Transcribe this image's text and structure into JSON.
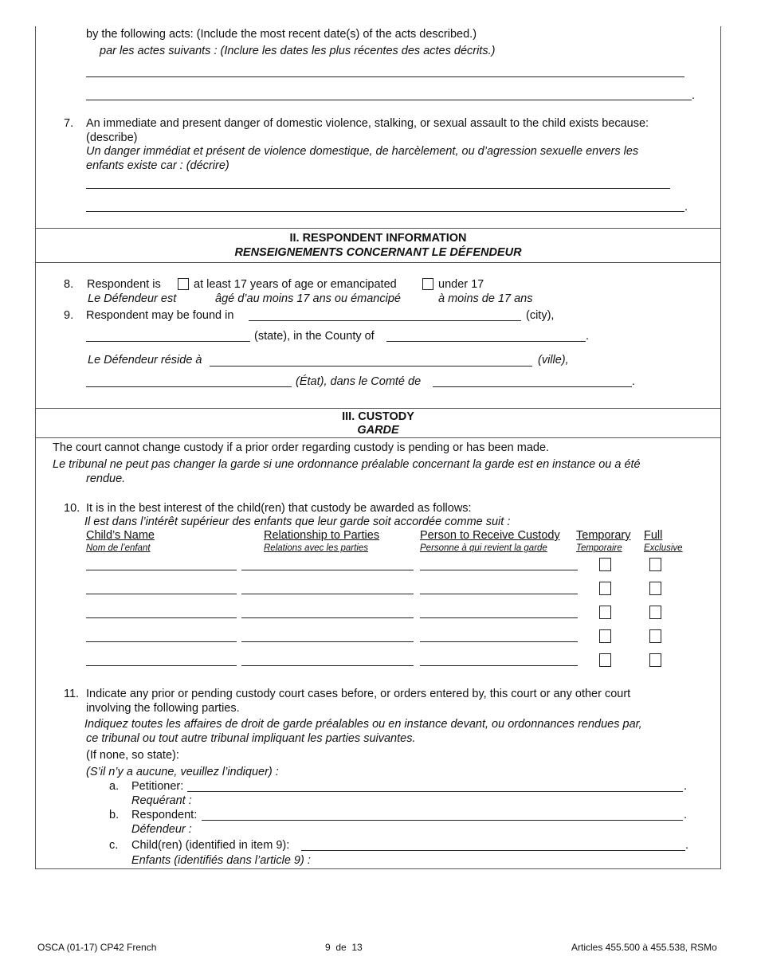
{
  "item6_cont": {
    "en": "by the following acts:  (Include the most recent date(s) of the acts described.)",
    "fr": "par les actes suivants : (Inclure les dates les plus récentes des actes décrits.)"
  },
  "item7": {
    "number": "7.",
    "en_line1": "An immediate and present danger of domestic violence, stalking, or sexual assault to the child exists because:",
    "en_line2": "(describe)",
    "fr_line1": "Un danger immédiat et présent de violence domestique, de harcèlement, ou d’agression sexuelle envers les",
    "fr_line2": "enfants existe car : (décrire)"
  },
  "section2": {
    "title": "II. RESPONDENT INFORMATION",
    "subtitle": "RENSEIGNEMENTS CONCERNANT LE DÉFENDEUR"
  },
  "item8": {
    "number": "8.",
    "label_en": "Respondent is",
    "label_fr": "Le Défendeur est",
    "option1_en": "at least 17 years of age or emancipated",
    "option1_fr": "âgé d’au moins 17 ans ou émancipé",
    "option2_en": "under 17",
    "option2_fr": "à moins de 17 ans"
  },
  "item9": {
    "number": "9.",
    "en_prefix": "Respondent may be found in",
    "city_en": "(city),",
    "state_en": "(state), in the County of",
    "fr_prefix": "Le Défendeur réside à",
    "city_fr": "(ville),",
    "state_fr": "(État), dans le Comté de",
    "period": "."
  },
  "section3": {
    "title": "III. CUSTODY",
    "subtitle": "GARDE",
    "notice_en": "The court cannot change custody if a prior order regarding custody is pending or has been made.",
    "notice_fr_line1": "Le tribunal ne peut pas changer la garde si une ordonnance préalable concernant la garde est en instance ou a été",
    "notice_fr_line2": "rendue."
  },
  "item10": {
    "number": "10.",
    "en": "It is in the best interest of the child(ren) that custody be awarded as follows:",
    "fr": "Il est dans l’intérêt supérieur des enfants que leur garde soit accordée comme suit :",
    "columns": [
      {
        "en": "Child’s Name",
        "fr": "Nom de l’enfant"
      },
      {
        "en": "Relationship to Parties",
        "fr": "Relations avec les parties"
      },
      {
        "en": "Person to Receive Custody",
        "fr": "Personne à qui revient la garde"
      },
      {
        "en": "Temporary",
        "fr": "Temporaire"
      },
      {
        "en": "Full",
        "fr": "Exclusive"
      }
    ],
    "rows": [
      {
        "child_name": "",
        "relationship": "",
        "person": "",
        "temporary": false,
        "full": false
      },
      {
        "child_name": "",
        "relationship": "",
        "person": "",
        "temporary": false,
        "full": false
      },
      {
        "child_name": "",
        "relationship": "",
        "person": "",
        "temporary": false,
        "full": false
      },
      {
        "child_name": "",
        "relationship": "",
        "person": "",
        "temporary": false,
        "full": false
      },
      {
        "child_name": "",
        "relationship": "",
        "person": "",
        "temporary": false,
        "full": false
      }
    ]
  },
  "item11": {
    "number": "11.",
    "en_line1": "Indicate any prior or pending custody court cases before, or orders entered by, this court or any other court",
    "en_line2": "involving the following parties.",
    "fr_line1": "Indiquez toutes les affaires de droit de garde préalables ou en instance devant, ou ordonnances rendues par,",
    "fr_line2": "ce tribunal ou tout autre tribunal impliquant les parties suivantes.",
    "none_en": "(If none, so state):",
    "none_fr": "(S’il n’y a aucune, veuillez l’indiquer) :",
    "parties": [
      {
        "letter": "a.",
        "en": "Petitioner:",
        "fr": "Requérant :"
      },
      {
        "letter": "b.",
        "en": "Respondent:",
        "fr": "Défendeur :"
      },
      {
        "letter": "c.",
        "en": "Child(ren) (identified in item 9):",
        "fr": "Enfants (identifiés dans l’article 9) :"
      }
    ]
  },
  "footer": {
    "form_id": "OSCA (01-17) CP42 French",
    "page": "9  de  13",
    "statute": "Articles 455.500 à 455.538, RSMo"
  }
}
